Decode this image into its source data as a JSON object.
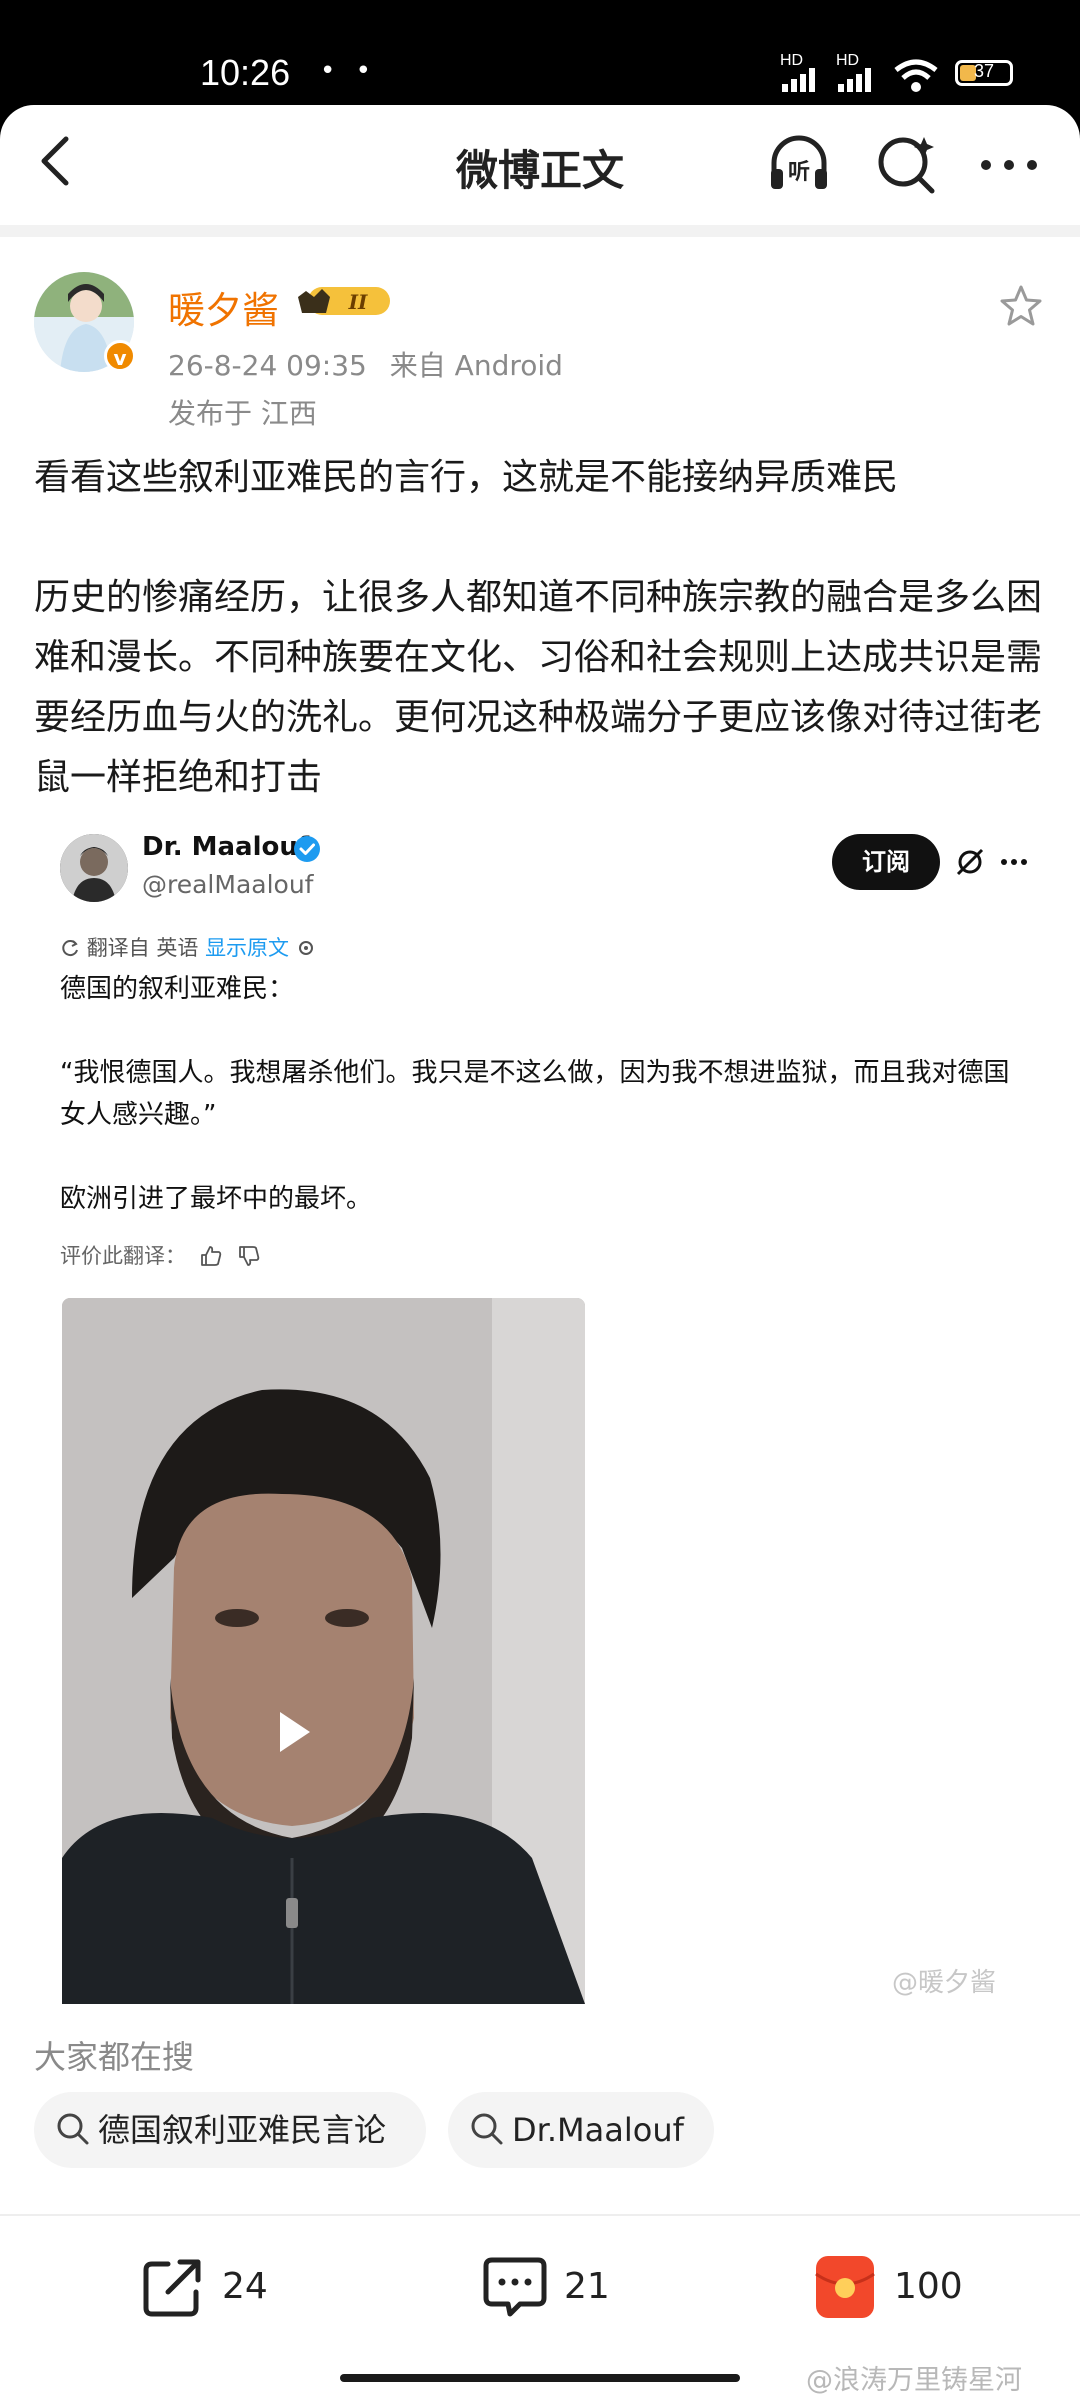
{
  "status_bar": {
    "time": "10:26",
    "dots": "• •",
    "signal1": "HD",
    "signal2": "HD",
    "battery": "37"
  },
  "nav": {
    "title": "微博正文",
    "listen_icon_text": "听"
  },
  "post": {
    "username": "暖夕酱",
    "level_label": "II",
    "verified_badge": "v",
    "timestamp": "26-8-24 09:35",
    "source": "来自 Android",
    "location": "发布于 江西",
    "paragraph1": "看看这些叙利亚难民的言行，这就是不能接纳异质难民",
    "paragraph2": "历史的惨痛经历，让很多人都知道不同种族宗教的融合是多么困难和漫长。不同种族要在文化、习俗和社会规则上达成共识是需要经历血与火的洗礼。更何况这种极端分子更应该像对待过街老鼠一样拒绝和打击"
  },
  "embedded_tweet": {
    "name": "Dr. Maalouf",
    "handle": "@realMaalouf",
    "subscribe_label": "订阅",
    "translated_prefix": "翻译自 英语",
    "show_original": "显示原文",
    "line1": "德国的叙利亚难民：",
    "line2": "“我恨德国人。我想屠杀他们。我只是不这么做，因为我不想进监狱，而且我对德国女人感兴趣。”",
    "line3": "欧洲引进了最坏中的最坏。",
    "rate_label": "评价此翻译："
  },
  "video": {
    "watermark": "@暖夕酱"
  },
  "search": {
    "title": "大家都在搜",
    "chips": [
      "德国叙利亚难民言论",
      "Dr.Maalouf"
    ]
  },
  "actions": {
    "reposts": "24",
    "comments": "21",
    "likes": "100"
  },
  "page_watermark": "@浪涛万里铸星河",
  "colors": {
    "username": "#f07300",
    "link_blue": "#1d9bf0",
    "like_red": "#f2482b"
  }
}
